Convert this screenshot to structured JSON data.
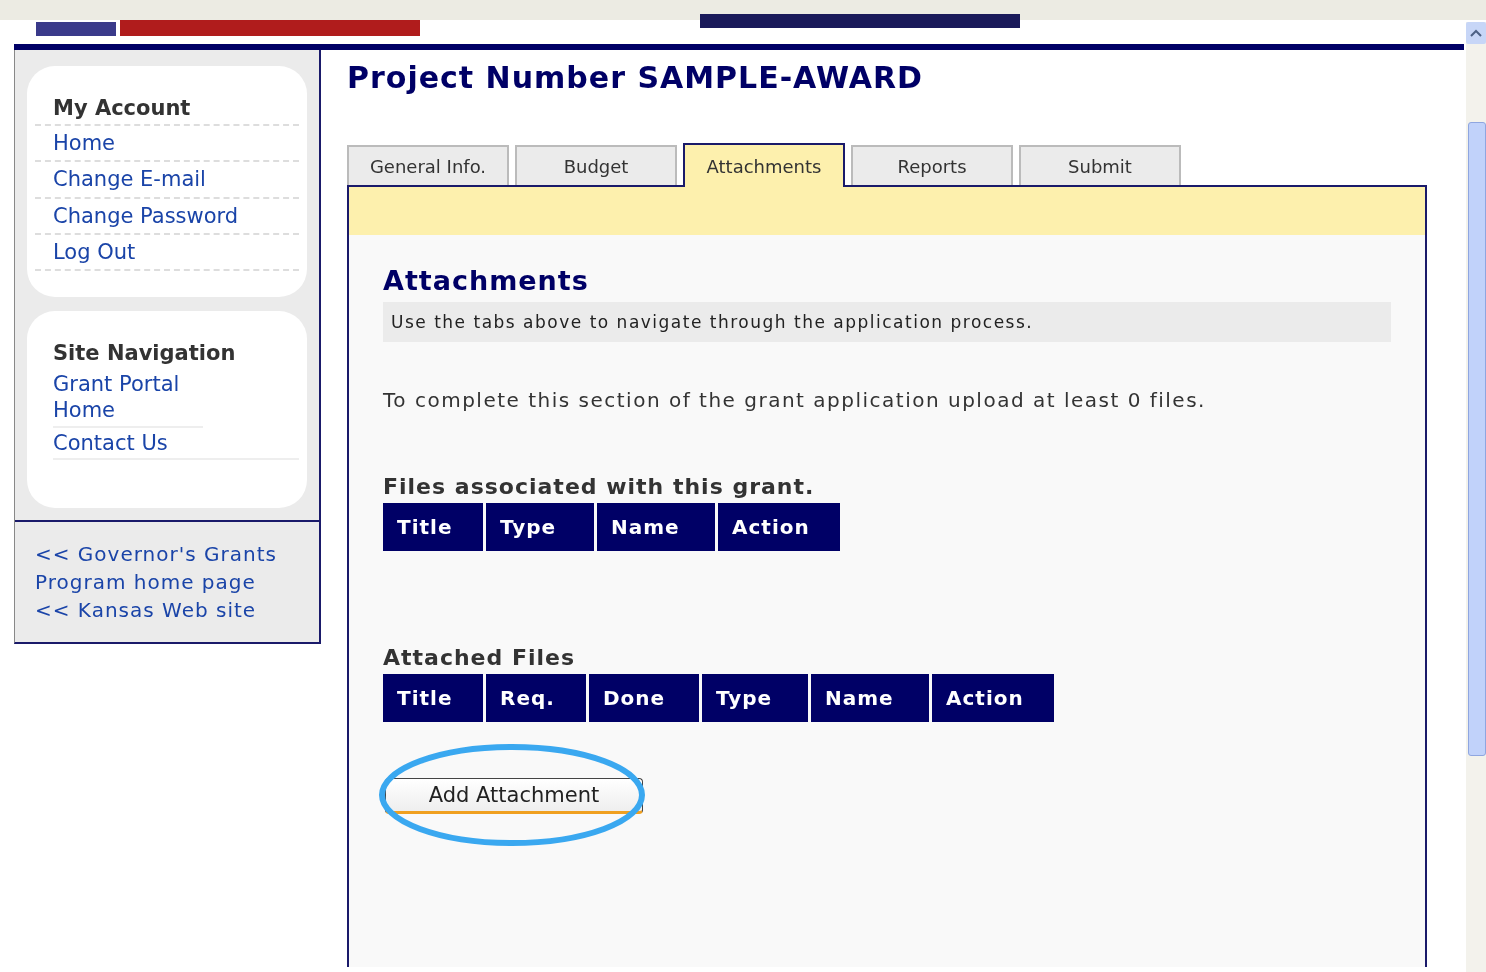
{
  "page_title": "Project Number SAMPLE-AWARD",
  "sidebar": {
    "sections": [
      {
        "heading": "My Account",
        "links": [
          "Home",
          "Change E-mail",
          "Change Password",
          "Log Out"
        ]
      },
      {
        "heading": "Site Navigation",
        "links": [
          "Grant Portal Home",
          "Contact Us"
        ]
      }
    ],
    "footer_links": [
      "<< Governor's Grants Program home page",
      "<< Kansas Web site"
    ]
  },
  "tabs": [
    {
      "label": "General Info.",
      "selected": false
    },
    {
      "label": "Budget",
      "selected": false
    },
    {
      "label": "Attachments",
      "selected": true
    },
    {
      "label": "Reports",
      "selected": false
    },
    {
      "label": "Submit",
      "selected": false
    }
  ],
  "section": {
    "title": "Attachments",
    "hint": "Use the tabs above to navigate through the application process.",
    "instruction": "To complete this section of the grant application upload at least 0 files."
  },
  "tables": [
    {
      "caption": "Files associated with this grant.",
      "columns": [
        "Title",
        "Type",
        "Name",
        "Action"
      ]
    },
    {
      "caption": "Attached Files",
      "columns": [
        "Title",
        "Req.",
        "Done",
        "Type",
        "Name",
        "Action"
      ]
    }
  ],
  "add_button": {
    "label": "Add Attachment",
    "highlighted": true
  }
}
